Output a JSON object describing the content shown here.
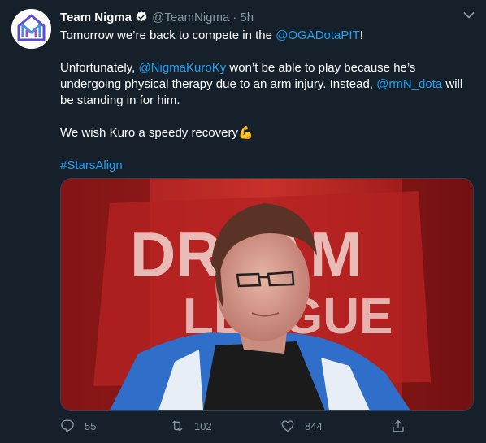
{
  "tweet": {
    "display_name": "Team Nigma",
    "handle": "@TeamNigma",
    "separator": "·",
    "time": "5h",
    "line1_prefix": "Tomorrow we’re back to compete in the ",
    "line1_mention": "@OGADotaPIT",
    "line1_suffix": "!",
    "para2_prefix": "Unfortunately, ",
    "para2_mention1": "@NigmaKuroKy",
    "para2_mid": " won’t be able to play because he’s undergoing physical therapy due to an arm injury. Instead, ",
    "para2_mention2": "@rmN_dota",
    "para2_suffix": " will be standing in for him.",
    "para3": "We wish Kuro a speedy recovery",
    "emoji": "💪",
    "hashtag": "#StarsAlign",
    "media_sign_word1": "DREAM",
    "media_sign_word2": "LEAGUE"
  },
  "actions": {
    "reply_count": "55",
    "retweet_count": "102",
    "like_count": "844"
  },
  "colors": {
    "background": "#15202b",
    "link": "#1da1f2",
    "muted": "#8899a6",
    "verified": "#ffffff"
  },
  "icons": [
    "nigma-logo-icon",
    "verified-badge-icon",
    "chevron-down-icon",
    "reply-icon",
    "retweet-icon",
    "like-icon",
    "share-icon"
  ]
}
